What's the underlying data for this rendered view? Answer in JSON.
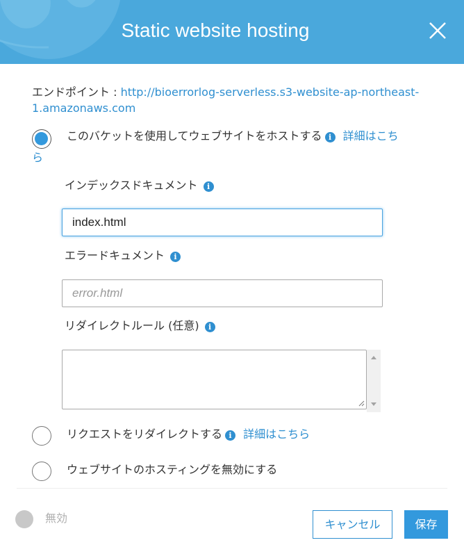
{
  "header": {
    "title": "Static website hosting"
  },
  "endpoint": {
    "label": "エンドポイント : ",
    "url_line1": "http://bioerrorlog-serverless.s3-website-ap-northeast-",
    "url_line2": "1.amazonaws.com"
  },
  "options": [
    {
      "label": "このバケットを使用してウェブサイトをホストする",
      "link_line1": "詳細はこち",
      "link_line2": "ら",
      "selected": true
    },
    {
      "label": "リクエストをリダイレクトする",
      "link": "詳細はこちら",
      "selected": false
    },
    {
      "label": "ウェブサイトのホスティングを無効にする",
      "selected": false
    }
  ],
  "fields": {
    "index_label": "インデックスドキュメント",
    "index_value": "index.html",
    "error_label": "エラードキュメント",
    "error_placeholder": "error.html",
    "redirect_label": "リダイレクトルール (任意)",
    "redirect_value": ""
  },
  "footer": {
    "status_label": "無効",
    "cancel_label": "キャンセル",
    "save_label": "保存"
  },
  "icons": {
    "info": "i"
  },
  "colors": {
    "header_bg": "#4aa8dc",
    "accent": "#2f8fd0",
    "radio_fill": "#3399dd",
    "disabled_gray": "#c8c8c8"
  }
}
